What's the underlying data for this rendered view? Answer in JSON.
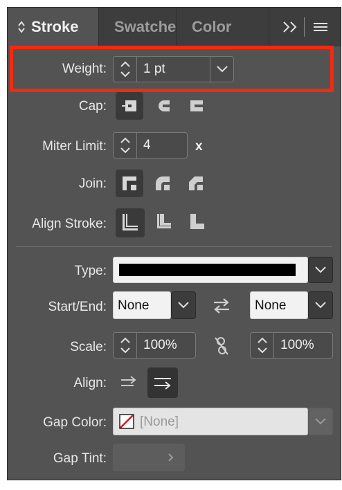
{
  "panel": {
    "tabs": [
      {
        "label": "Stroke",
        "active": true
      },
      {
        "label": "Swatches",
        "active": false
      },
      {
        "label": "Color",
        "active": false
      }
    ],
    "tab_prefix_icon": "updown-chevrons-icon",
    "overflow_icon": "double-chevron-right-icon",
    "menu_icon": "hamburger-menu-icon"
  },
  "weight": {
    "label": "Weight:",
    "value": "1 pt"
  },
  "cap": {
    "label": "Cap:",
    "options": [
      "butt-cap-icon",
      "round-cap-icon",
      "projecting-cap-icon"
    ],
    "selected": 0
  },
  "miter": {
    "label": "Miter Limit:",
    "value": "4",
    "unit": "x"
  },
  "join": {
    "label": "Join:",
    "options": [
      "miter-join-icon",
      "round-join-icon",
      "bevel-join-icon"
    ],
    "selected": 0
  },
  "align_stroke": {
    "label": "Align Stroke:",
    "options": [
      "align-center-icon",
      "align-inside-icon",
      "align-outside-icon"
    ],
    "selected": 0
  },
  "type": {
    "label": "Type:"
  },
  "start_end": {
    "label": "Start/End:",
    "start": "None",
    "end": "None"
  },
  "scale": {
    "label": "Scale:",
    "start": "100%",
    "end": "100%"
  },
  "align": {
    "label": "Align:",
    "selected": 1
  },
  "gap_color": {
    "label": "Gap Color:",
    "value": "[None]"
  },
  "gap_tint": {
    "label": "Gap Tint:"
  },
  "colors": {
    "highlight": "#f42a0f",
    "panel_bg": "#535353",
    "tab_bar": "#3d3d3d"
  }
}
